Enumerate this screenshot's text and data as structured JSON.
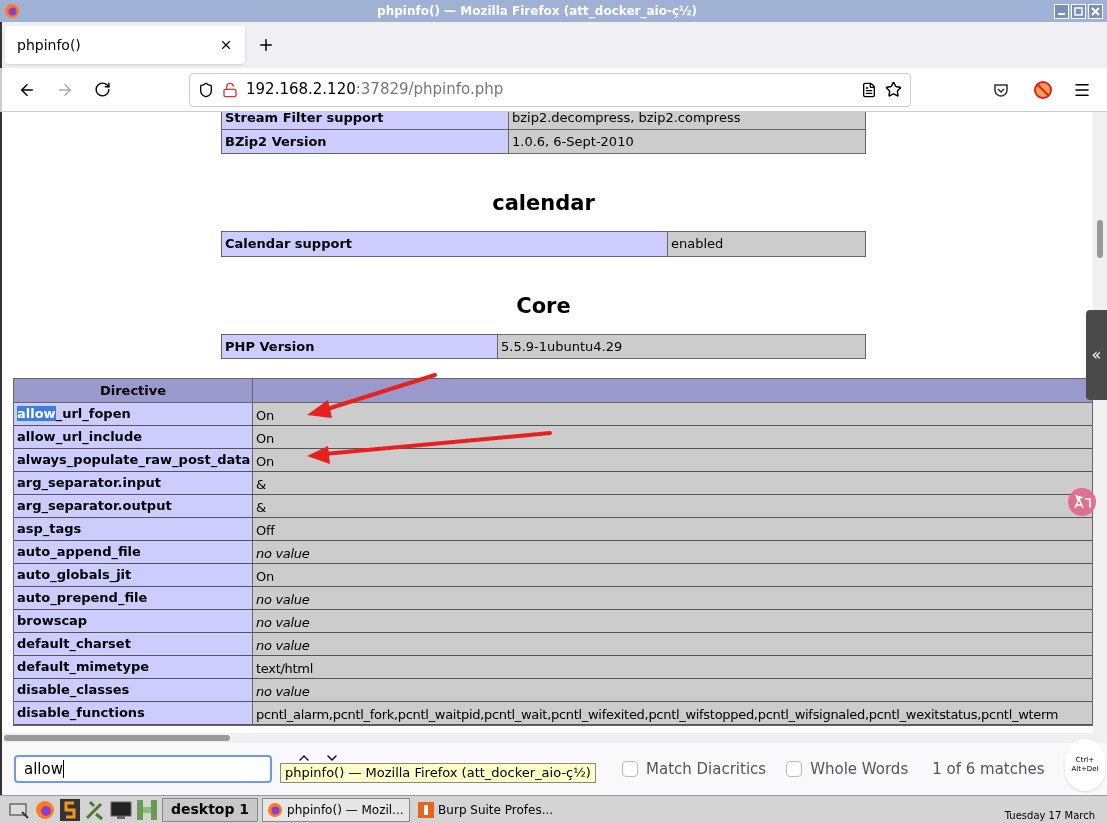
{
  "window": {
    "title": "phpinfo() — Mozilla Firefox (att_docker_aio-ç½)"
  },
  "tabs": [
    {
      "label": "phpinfo()",
      "selected": true
    }
  ],
  "address": {
    "host": "192.168.2.120",
    "rest": ":37829/phpinfo.php"
  },
  "top_table": [
    {
      "label": "Stream Filter support",
      "value": "bzip2.decompress, bzip2.compress"
    },
    {
      "label": "BZip2 Version",
      "value": "1.0.6, 6-Sept-2010"
    }
  ],
  "sections": [
    {
      "heading": "calendar",
      "rows": [
        {
          "label": "Calendar support",
          "value": "enabled"
        }
      ]
    },
    {
      "heading": "Core",
      "rows": [
        {
          "label": "PHP Version",
          "value": "5.5.9-1ubuntu4.29"
        }
      ]
    }
  ],
  "directive_table": {
    "columns": [
      "Directive"
    ],
    "rows": [
      {
        "match": "allow",
        "name": "_url_fopen",
        "value": "On",
        "kind": "text"
      },
      {
        "name": "allow_url_include",
        "value": "On",
        "kind": "text"
      },
      {
        "name": "always_populate_raw_post_data",
        "value": "On",
        "kind": "text"
      },
      {
        "name": "arg_separator.input",
        "value": "&",
        "kind": "text"
      },
      {
        "name": "arg_separator.output",
        "value": "&",
        "kind": "text"
      },
      {
        "name": "asp_tags",
        "value": "Off",
        "kind": "text"
      },
      {
        "name": "auto_append_file",
        "value": "no value",
        "kind": "none"
      },
      {
        "name": "auto_globals_jit",
        "value": "On",
        "kind": "text"
      },
      {
        "name": "auto_prepend_file",
        "value": "no value",
        "kind": "none"
      },
      {
        "name": "browscap",
        "value": "no value",
        "kind": "none"
      },
      {
        "name": "default_charset",
        "value": "no value",
        "kind": "none"
      },
      {
        "name": "default_mimetype",
        "value": "text/html",
        "kind": "text"
      },
      {
        "name": "disable_classes",
        "value": "no value",
        "kind": "none"
      },
      {
        "name": "disable_functions",
        "value": "pcntl_alarm,pcntl_fork,pcntl_waitpid,pcntl_wait,pcntl_wifexited,pcntl_wifstopped,pcntl_wifsignaled,pcntl_wexitstatus,pcntl_wterm",
        "kind": "text"
      }
    ]
  },
  "find_bar": {
    "value": "allow",
    "options": [
      {
        "label": "Match Diacritics",
        "checked": false
      },
      {
        "label": "Whole Words",
        "checked": false
      }
    ],
    "result": "1 of 6 matches"
  },
  "tooltip": "phpinfo() — Mozilla Firefox (att_docker_aio-ç½)",
  "side_button": "«",
  "ctrl_alt_del": "Ctrl+ Alt+Del",
  "taskbar": {
    "desktop": "desktop 1",
    "tasks": [
      {
        "label": "phpinfo() — Mozil...",
        "selected": true,
        "kind": "firefox"
      },
      {
        "label": "Burp Suite Profes...",
        "selected": false,
        "kind": "burp"
      }
    ],
    "date": "Tuesday 17 March"
  }
}
